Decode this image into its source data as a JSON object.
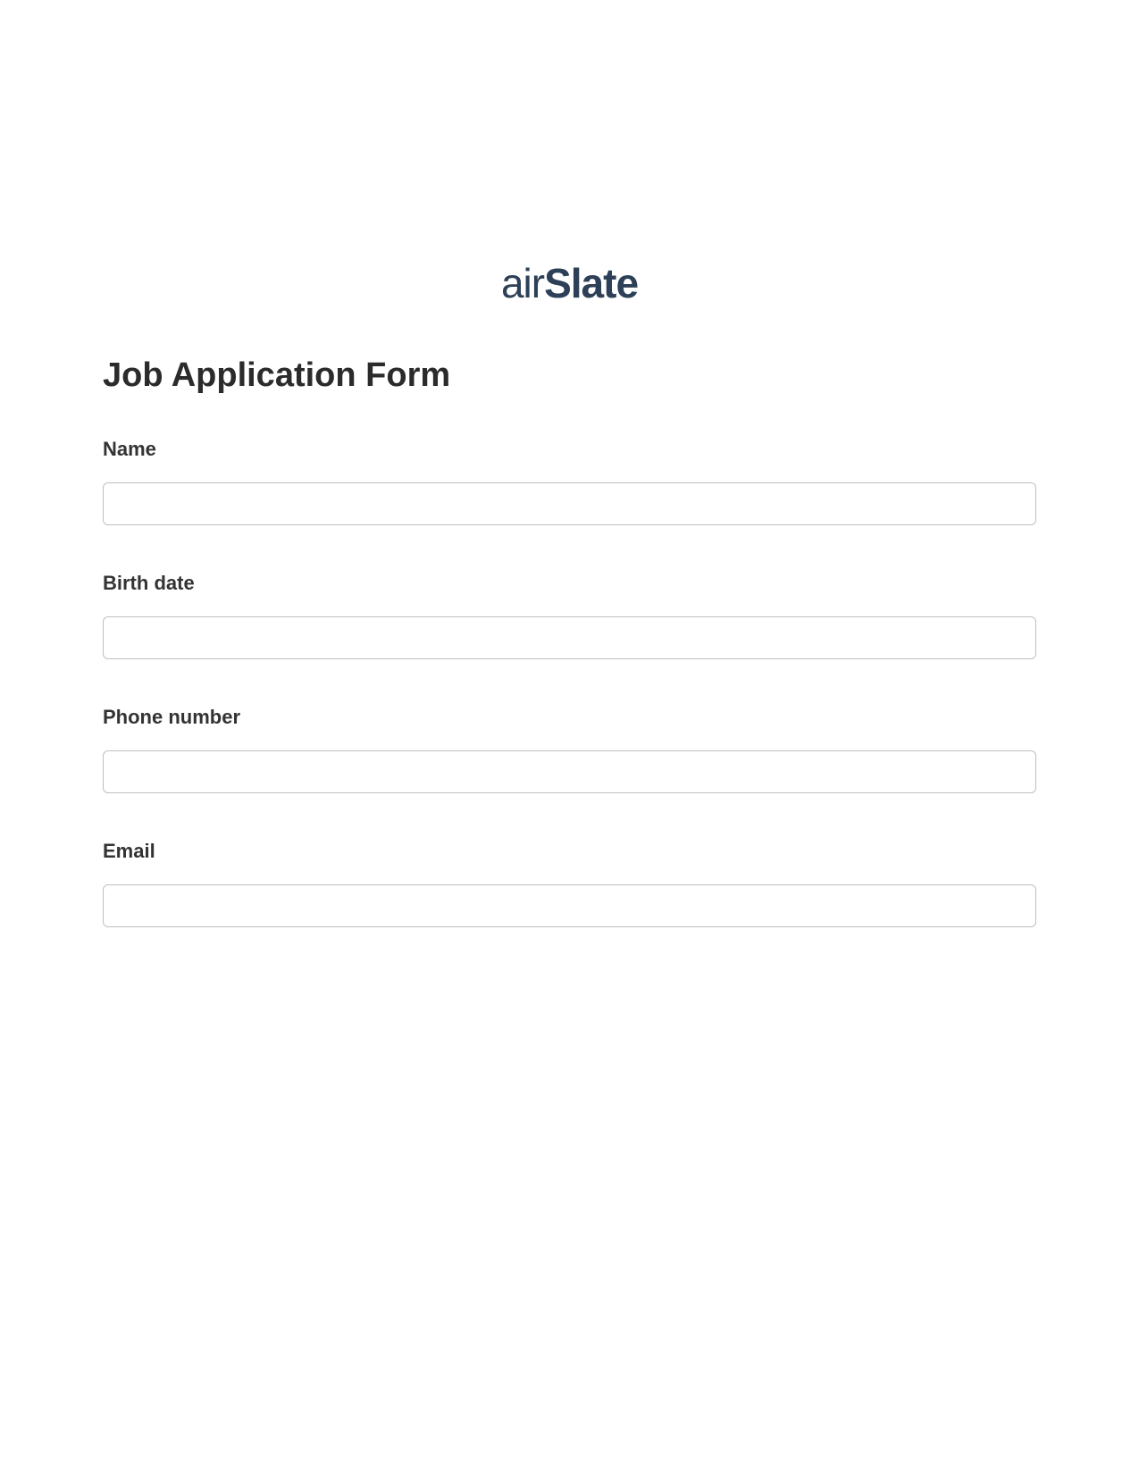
{
  "logo": {
    "prefix": "air",
    "suffix": "Slate"
  },
  "form": {
    "title": "Job Application Form",
    "fields": {
      "name": {
        "label": "Name",
        "value": ""
      },
      "birthdate": {
        "label": "Birth date",
        "value": ""
      },
      "phone": {
        "label": "Phone number",
        "value": ""
      },
      "email": {
        "label": "Email",
        "value": ""
      }
    }
  }
}
